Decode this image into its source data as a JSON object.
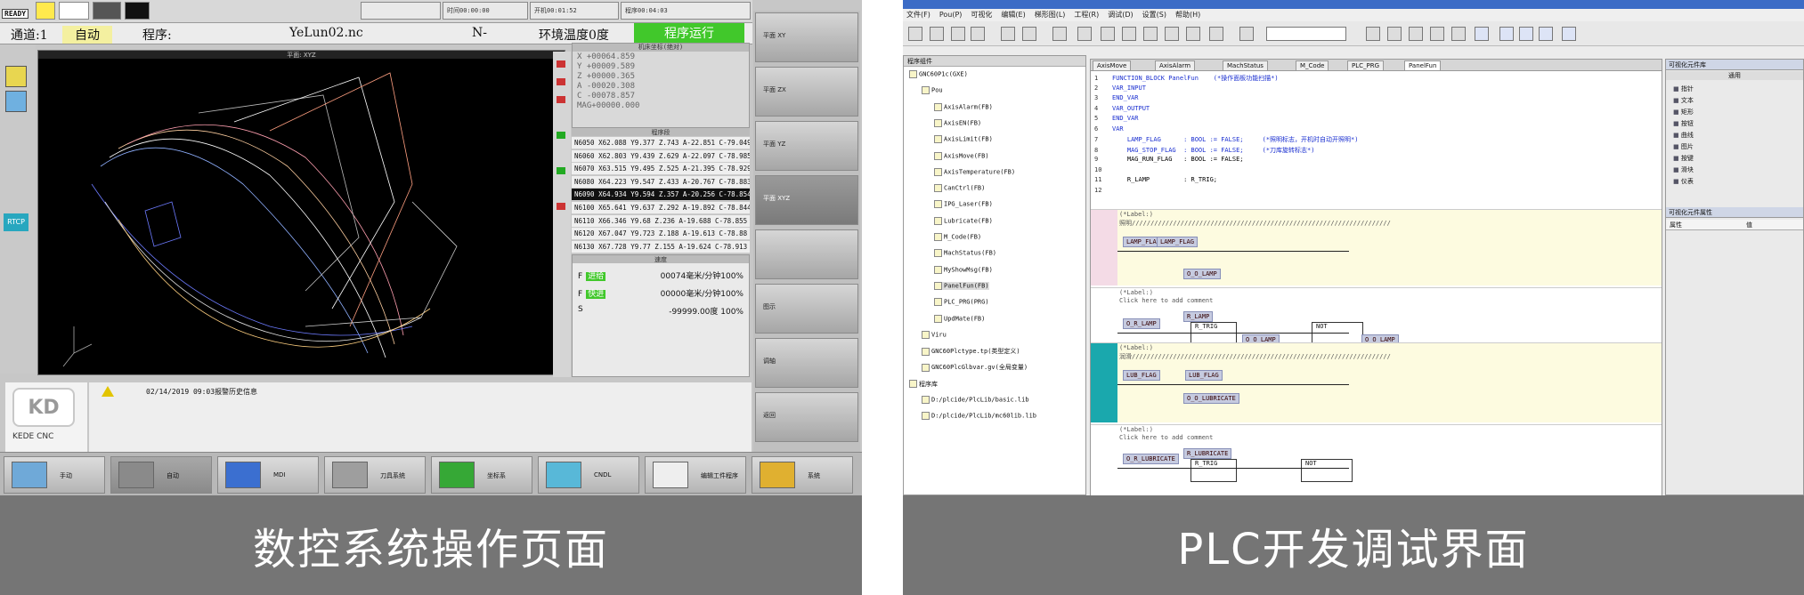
{
  "captions": {
    "left": "数控系统操作页面",
    "right": "PLC开发调试界面"
  },
  "cnc": {
    "ready": "READY",
    "top_values": [
      "时间00:00:00",
      "开机00:01:52",
      "程序00:04:03"
    ],
    "status": {
      "channel": "通道:1",
      "mode": "自动",
      "program_label": "程序:",
      "program_name": "YeLun02.nc",
      "n_value": "N-",
      "temperature": "环境温度0度",
      "run_state": "程序运行"
    },
    "viewport_title": "平面: XYZ",
    "left_tools": [
      "RTCP"
    ],
    "coords": [
      "X  +00064.859",
      "Y  +00009.589",
      "Z  +00000.365",
      "A  -00020.308",
      "C  -00078.857",
      "MAG+00000.000"
    ],
    "coords_title": "机床坐标(绝对)",
    "program_title": "程序段",
    "program_lines": [
      "N6050 X62.088 Y9.377 Z.743 A-22.851 C-79.049",
      "N6060 X62.803 Y9.439 Z.629 A-22.097 C-78.985",
      "N6070 X63.515 Y9.495 Z.525 A-21.395 C-78.929",
      "N6080 X64.223 Y9.547 Z.433 A-20.767 C-78.883",
      "N6090 X64.934 Y9.594 Z.357 A-20.256 C-78.854",
      "N6100 X65.641 Y9.637 Z.292 A-19.892 C-78.844",
      "N6110 X66.346 Y9.68 Z.236 A-19.688 C-78.855",
      "N6120 X67.047 Y9.723 Z.188 A-19.613 C-78.88",
      "N6130 X67.728 Y9.77 Z.155 A-19.624 C-78.913"
    ],
    "highlight_index": 4,
    "feed_title": "速度",
    "feed": [
      {
        "axis": "F",
        "name": "进给",
        "value": "00074毫米/分钟100%"
      },
      {
        "axis": "F",
        "name": "快进",
        "value": "00000毫米/分钟100%"
      },
      {
        "axis": "S",
        "name": "",
        "value": "-99999.00度        100%"
      }
    ],
    "alarm": "02/14/2019 09:03报警历史信息",
    "logo": "KEDE CNC",
    "right_buttons": [
      "平面 XY",
      "平面 ZX",
      "平面 YZ",
      "平面 XYZ",
      "",
      "图示",
      "调轴",
      "返回"
    ],
    "softkeys": [
      "手动",
      "自动",
      "MDI",
      "刀具系统",
      "坐标系",
      "CNDL",
      "编辑工件程序",
      "系统"
    ]
  },
  "plc": {
    "menu": [
      "文件(F)",
      "Pou(P)",
      "可视化",
      "编辑(E)",
      "梯形图(L)",
      "工程(R)",
      "调试(D)",
      "设置(S)",
      "帮助(H)"
    ],
    "tree_header": "程序组件",
    "tree": [
      {
        "label": "GNC60P1c(GXE)",
        "indent": 0
      },
      {
        "label": "Pou",
        "indent": 1
      },
      {
        "label": "AxisAlarm(FB)",
        "indent": 2
      },
      {
        "label": "AxisEN(FB)",
        "indent": 2
      },
      {
        "label": "AxisLimit(FB)",
        "indent": 2
      },
      {
        "label": "AxisMove(FB)",
        "indent": 2
      },
      {
        "label": "AxisTemperature(FB)",
        "indent": 2
      },
      {
        "label": "CanCtrl(FB)",
        "indent": 2
      },
      {
        "label": "IPG_Laser(FB)",
        "indent": 2
      },
      {
        "label": "Lubricate(FB)",
        "indent": 2
      },
      {
        "label": "M_Code(FB)",
        "indent": 2
      },
      {
        "label": "MachStatus(FB)",
        "indent": 2
      },
      {
        "label": "MyShowMsg(FB)",
        "indent": 2
      },
      {
        "label": "PanelFun(FB)",
        "indent": 2
      },
      {
        "label": "PLC_PRG(PRG)",
        "indent": 2
      },
      {
        "label": "UpdMate(FB)",
        "indent": 2
      },
      {
        "label": "Viru",
        "indent": 1
      },
      {
        "label": "GNC60Plctype.tp(类型定义)",
        "indent": 1
      },
      {
        "label": "GNC60PlcGlbvar.gv(全局变量)",
        "indent": 1
      },
      {
        "label": "程序库",
        "indent": 0
      },
      {
        "label": "D:/plcide/PlcLib/basic.lib",
        "indent": 1
      },
      {
        "label": "D:/plcide/PlcLib/mc60lib.lib",
        "indent": 1
      }
    ],
    "selected_tree": 13,
    "tabs": [
      "AxisMove",
      "AxisAlarm",
      "MachStatus",
      "M_Code",
      "PLC_PRG",
      "PanelFun"
    ],
    "active_tab": 5,
    "code": [
      {
        "n": "1",
        "t": "FUNCTION_BLOCK PanelFun    (*操作面板功能扫描*)"
      },
      {
        "n": "2",
        "t": "VAR_INPUT"
      },
      {
        "n": "3",
        "t": "END_VAR"
      },
      {
        "n": "4",
        "t": "VAR_OUTPUT"
      },
      {
        "n": "5",
        "t": "END_VAR"
      },
      {
        "n": "6",
        "t": "VAR"
      },
      {
        "n": "7",
        "t": "    LAMP_FLAG      : BOOL := FALSE;     (*照明标志，开机时自动开照明*)"
      },
      {
        "n": "8",
        "t": "    MAG_STOP_FLAG  : BOOL := FALSE;     (*刀库旋转标志*)"
      },
      {
        "n": "9",
        "t": "    MAG_RUN_FLAG   : BOOL := FALSE;"
      },
      {
        "n": "10",
        "t": ""
      },
      {
        "n": "11",
        "t": "    R_LAMP         : R_TRIG;"
      },
      {
        "n": "12",
        "t": ""
      }
    ],
    "nets": [
      {
        "id": "0001",
        "comment": "(*Label:)",
        "text": "照明/////////////////////////////////////////////////////////////////////",
        "vars": [
          "LAMP_FLAG",
          "LAMP_FLAG",
          "O_O_LAMP"
        ]
      },
      {
        "id": "0002",
        "comment": "(*Label:)",
        "text": "Click here to add comment",
        "vars": [
          "O_R_LAMP",
          "R_LAMP",
          "R_TRIG",
          "O_O_LAMP",
          "NOT",
          "O_O_LAMP"
        ]
      },
      {
        "id": "0003",
        "comment": "(*Label:)",
        "text": "润滑/////////////////////////////////////////////////////////////////////",
        "vars": [
          "LUB_FLAG",
          "LUB_FLAG",
          "O_O_LUBRICATE"
        ]
      },
      {
        "id": "0004",
        "comment": "(*Label:)",
        "text": "Click here to add comment",
        "vars": [
          "O_R_LUBRICATE",
          "R_LUBRICATE",
          "R_TRIG",
          "NOT"
        ]
      }
    ],
    "props": {
      "header1": "可视化元件库",
      "tab": "通用",
      "items": [
        "指针",
        "文本",
        "矩形",
        "按钮",
        "曲线",
        "图片",
        "按键",
        "滑块",
        "仪表"
      ],
      "header2": "可视化元件属性",
      "col1": "属性",
      "col2": "值"
    }
  }
}
